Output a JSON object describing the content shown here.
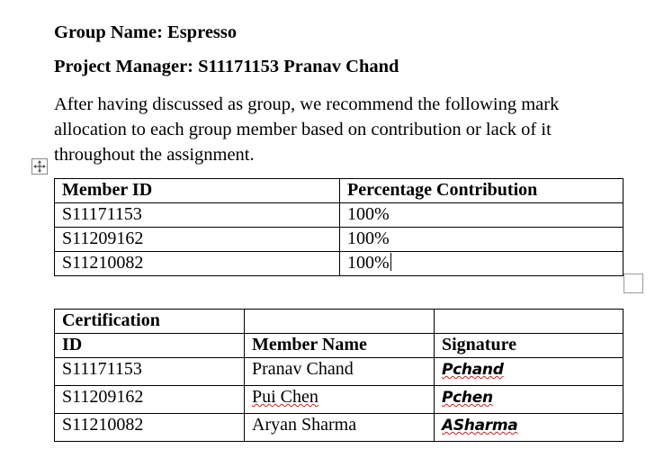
{
  "group_line": "Group Name: Espresso",
  "manager_line": "Project Manager: S11171153 Pranav Chand",
  "intro": "After having discussed as group, we recommend the following mark allocation to each group member based on contribution or lack of it throughout the assignment.",
  "contribution_table": {
    "headers": [
      "Member ID",
      "Percentage Contribution"
    ],
    "rows": [
      [
        "S11171153",
        "100%"
      ],
      [
        "S11209162",
        "100%"
      ],
      [
        "S11210082",
        "100%"
      ]
    ]
  },
  "certification_table": {
    "header_top": "Certification",
    "headers": [
      "ID",
      "Member Name",
      "Signature"
    ],
    "rows": [
      [
        "S11171153",
        "Pranav Chand",
        "Pchand"
      ],
      [
        "S11209162",
        "Pui Chen",
        "Pchen"
      ],
      [
        "S11210082",
        "Aryan Sharma",
        "ASharma"
      ]
    ]
  },
  "icons": {
    "table_move": "move-arrows-icon",
    "table_resize": "resize-square-icon"
  },
  "colors": {
    "spell_underline": "#d02020"
  }
}
